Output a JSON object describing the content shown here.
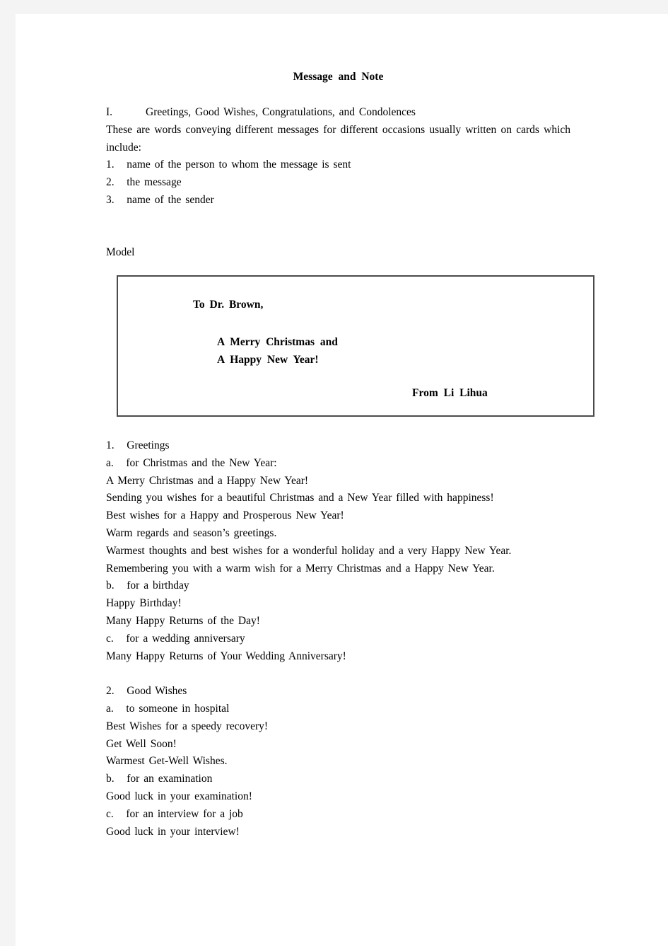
{
  "document": {
    "title": "Message and Note",
    "section_one": {
      "roman_label": "I.",
      "roman_heading": "Greetings, Good Wishes, Congratulations, and Condolences",
      "intro": "These are words conveying different messages for different occasions usually written on cards which include:",
      "items": [
        {
          "num": "1.",
          "text": "name of the person to whom the message is sent"
        },
        {
          "num": "2.",
          "text": "the message"
        },
        {
          "num": "3.",
          "text": "name of the sender"
        }
      ],
      "model_label": "Model"
    },
    "model_card": {
      "salutation": "To Dr. Brown,",
      "message_line_1": "A Merry Christmas and",
      "message_line_2": "A Happy New Year!",
      "signature": "From Li Lihua"
    },
    "sections": [
      {
        "num": "1.",
        "heading": "Greetings",
        "subsections": [
          {
            "letter": "a.",
            "label": "for Christmas and the New Year:",
            "lines": [
              "A Merry Christmas and a Happy New Year!",
              "Sending you wishes for a beautiful Christmas and a New Year filled with happiness!",
              "Best wishes for a Happy and Prosperous New Year!",
              "Warm regards and season’s greetings.",
              "Warmest thoughts and best wishes for a wonderful holiday and a very Happy New Year.",
              "Remembering you with a warm wish for a Merry Christmas and a Happy New Year."
            ]
          },
          {
            "letter": "b.",
            "label": "for a birthday",
            "lines": [
              "Happy Birthday!",
              "Many Happy Returns of the Day!"
            ]
          },
          {
            "letter": "c.",
            "label": "for a wedding anniversary",
            "lines": [
              "Many Happy Returns of Your Wedding Anniversary!"
            ]
          }
        ]
      },
      {
        "num": "2.",
        "heading": "Good Wishes",
        "subsections": [
          {
            "letter": "a.",
            "label": "to someone in hospital",
            "lines": [
              "Best Wishes for a speedy recovery!",
              "Get Well Soon!",
              "Warmest Get-Well Wishes."
            ]
          },
          {
            "letter": "b.",
            "label": "for an examination",
            "lines": [
              "Good luck in your examination!"
            ]
          },
          {
            "letter": "c.",
            "label": "for an interview for a job",
            "lines": [
              "Good luck in your interview!"
            ]
          }
        ]
      }
    ]
  }
}
